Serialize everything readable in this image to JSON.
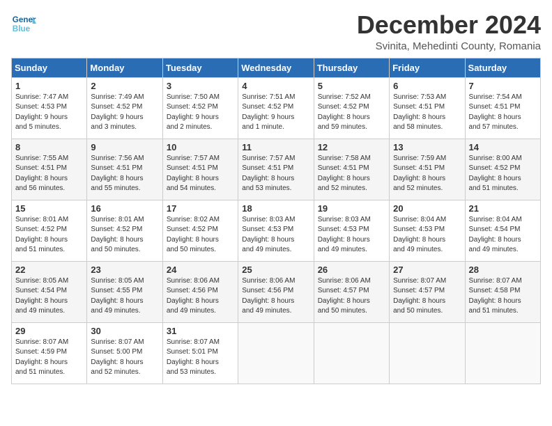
{
  "logo": {
    "general": "General",
    "blue": "Blue"
  },
  "title": "December 2024",
  "subtitle": "Svinita, Mehedinti County, Romania",
  "headers": [
    "Sunday",
    "Monday",
    "Tuesday",
    "Wednesday",
    "Thursday",
    "Friday",
    "Saturday"
  ],
  "weeks": [
    [
      {
        "day": "1",
        "info": "Sunrise: 7:47 AM\nSunset: 4:53 PM\nDaylight: 9 hours\nand 5 minutes."
      },
      {
        "day": "2",
        "info": "Sunrise: 7:49 AM\nSunset: 4:52 PM\nDaylight: 9 hours\nand 3 minutes."
      },
      {
        "day": "3",
        "info": "Sunrise: 7:50 AM\nSunset: 4:52 PM\nDaylight: 9 hours\nand 2 minutes."
      },
      {
        "day": "4",
        "info": "Sunrise: 7:51 AM\nSunset: 4:52 PM\nDaylight: 9 hours\nand 1 minute."
      },
      {
        "day": "5",
        "info": "Sunrise: 7:52 AM\nSunset: 4:52 PM\nDaylight: 8 hours\nand 59 minutes."
      },
      {
        "day": "6",
        "info": "Sunrise: 7:53 AM\nSunset: 4:51 PM\nDaylight: 8 hours\nand 58 minutes."
      },
      {
        "day": "7",
        "info": "Sunrise: 7:54 AM\nSunset: 4:51 PM\nDaylight: 8 hours\nand 57 minutes."
      }
    ],
    [
      {
        "day": "8",
        "info": "Sunrise: 7:55 AM\nSunset: 4:51 PM\nDaylight: 8 hours\nand 56 minutes."
      },
      {
        "day": "9",
        "info": "Sunrise: 7:56 AM\nSunset: 4:51 PM\nDaylight: 8 hours\nand 55 minutes."
      },
      {
        "day": "10",
        "info": "Sunrise: 7:57 AM\nSunset: 4:51 PM\nDaylight: 8 hours\nand 54 minutes."
      },
      {
        "day": "11",
        "info": "Sunrise: 7:57 AM\nSunset: 4:51 PM\nDaylight: 8 hours\nand 53 minutes."
      },
      {
        "day": "12",
        "info": "Sunrise: 7:58 AM\nSunset: 4:51 PM\nDaylight: 8 hours\nand 52 minutes."
      },
      {
        "day": "13",
        "info": "Sunrise: 7:59 AM\nSunset: 4:51 PM\nDaylight: 8 hours\nand 52 minutes."
      },
      {
        "day": "14",
        "info": "Sunrise: 8:00 AM\nSunset: 4:52 PM\nDaylight: 8 hours\nand 51 minutes."
      }
    ],
    [
      {
        "day": "15",
        "info": "Sunrise: 8:01 AM\nSunset: 4:52 PM\nDaylight: 8 hours\nand 51 minutes."
      },
      {
        "day": "16",
        "info": "Sunrise: 8:01 AM\nSunset: 4:52 PM\nDaylight: 8 hours\nand 50 minutes."
      },
      {
        "day": "17",
        "info": "Sunrise: 8:02 AM\nSunset: 4:52 PM\nDaylight: 8 hours\nand 50 minutes."
      },
      {
        "day": "18",
        "info": "Sunrise: 8:03 AM\nSunset: 4:53 PM\nDaylight: 8 hours\nand 49 minutes."
      },
      {
        "day": "19",
        "info": "Sunrise: 8:03 AM\nSunset: 4:53 PM\nDaylight: 8 hours\nand 49 minutes."
      },
      {
        "day": "20",
        "info": "Sunrise: 8:04 AM\nSunset: 4:53 PM\nDaylight: 8 hours\nand 49 minutes."
      },
      {
        "day": "21",
        "info": "Sunrise: 8:04 AM\nSunset: 4:54 PM\nDaylight: 8 hours\nand 49 minutes."
      }
    ],
    [
      {
        "day": "22",
        "info": "Sunrise: 8:05 AM\nSunset: 4:54 PM\nDaylight: 8 hours\nand 49 minutes."
      },
      {
        "day": "23",
        "info": "Sunrise: 8:05 AM\nSunset: 4:55 PM\nDaylight: 8 hours\nand 49 minutes."
      },
      {
        "day": "24",
        "info": "Sunrise: 8:06 AM\nSunset: 4:56 PM\nDaylight: 8 hours\nand 49 minutes."
      },
      {
        "day": "25",
        "info": "Sunrise: 8:06 AM\nSunset: 4:56 PM\nDaylight: 8 hours\nand 49 minutes."
      },
      {
        "day": "26",
        "info": "Sunrise: 8:06 AM\nSunset: 4:57 PM\nDaylight: 8 hours\nand 50 minutes."
      },
      {
        "day": "27",
        "info": "Sunrise: 8:07 AM\nSunset: 4:57 PM\nDaylight: 8 hours\nand 50 minutes."
      },
      {
        "day": "28",
        "info": "Sunrise: 8:07 AM\nSunset: 4:58 PM\nDaylight: 8 hours\nand 51 minutes."
      }
    ],
    [
      {
        "day": "29",
        "info": "Sunrise: 8:07 AM\nSunset: 4:59 PM\nDaylight: 8 hours\nand 51 minutes."
      },
      {
        "day": "30",
        "info": "Sunrise: 8:07 AM\nSunset: 5:00 PM\nDaylight: 8 hours\nand 52 minutes."
      },
      {
        "day": "31",
        "info": "Sunrise: 8:07 AM\nSunset: 5:01 PM\nDaylight: 8 hours\nand 53 minutes."
      },
      null,
      null,
      null,
      null
    ]
  ]
}
